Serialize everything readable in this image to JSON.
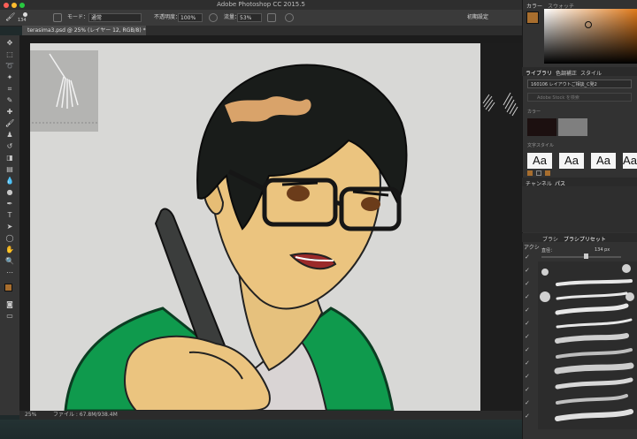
{
  "window": {
    "title": "Adobe Photoshop CC 2015.5"
  },
  "options_bar": {
    "brush_size": "134",
    "mode_label": "モード：",
    "mode_value": "通常",
    "opacity_label": "不透明度：",
    "opacity_value": "100%",
    "flow_label": "流量：",
    "flow_value": "53%",
    "workspace_button": "初期設定"
  },
  "document": {
    "tab_label": "terasima3.psd @ 25% (レイヤー 12, RGB/8) *",
    "zoom": "25%",
    "file_info": "ファイル : 67.8M/938.4M"
  },
  "panels": {
    "color_tab": "カラー",
    "swatches_tab": "スウォッチ",
    "library_tab": "ライブラリ",
    "adjust_tab": "色調補正",
    "style_tab": "スタイル",
    "library_select": "160106 レイアウトご相談_C発2",
    "library_search": "Adobe Stock を検索",
    "library_color_section": "カラー",
    "library_text_section": "文字スタイル",
    "aa_sample": "Aa",
    "channels_tab": "チャンネル",
    "paths_tab": "パス",
    "brush_tab": "ブラシ",
    "brush_presets_tab": "ブラシプリセット",
    "actions_tab": "アクシ",
    "diameter_label": "直径：",
    "diameter_value": "134 px"
  },
  "colors": {
    "foreground": "#a86e2e",
    "background": "#e2e2e2",
    "library_color1": "#1c1010",
    "library_color2": "#7f7f7f",
    "accent_close": "#fe5f57",
    "accent_min": "#febc2e",
    "accent_max": "#28c840"
  }
}
